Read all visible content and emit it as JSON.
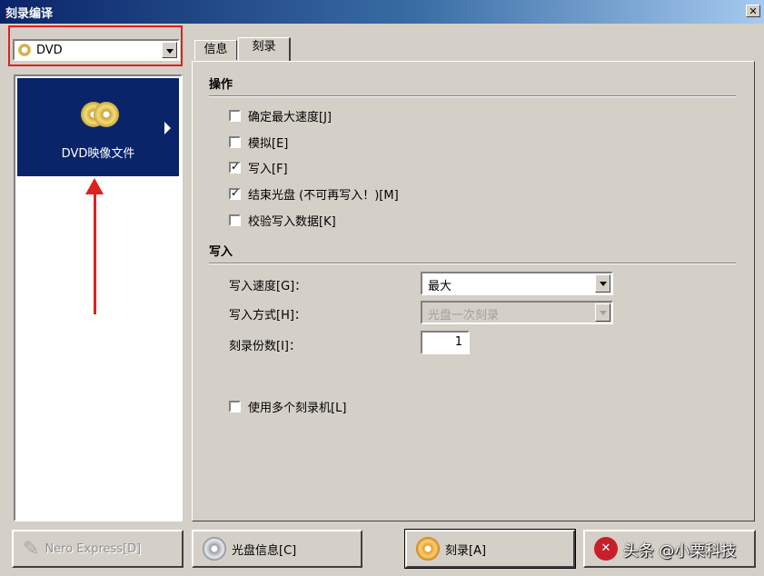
{
  "window": {
    "title": "刻录编译",
    "close_glyph": "✕"
  },
  "disc_type": {
    "selected": "DVD"
  },
  "left_list": {
    "items": [
      {
        "label": "DVD映像文件",
        "icon": "dvd-discs-icon"
      }
    ]
  },
  "tabs": [
    {
      "label": "信息"
    },
    {
      "label": "刻录"
    }
  ],
  "operations": {
    "title": "操作",
    "options": [
      {
        "label": "确定最大速度[J]",
        "checked": false
      },
      {
        "label": "模拟[E]",
        "checked": false
      },
      {
        "label": "写入[F]",
        "checked": true
      },
      {
        "label": "结束光盘 (不可再写入！)[M]",
        "checked": true
      },
      {
        "label": "校验写入数据[K]",
        "checked": false
      }
    ]
  },
  "write": {
    "title": "写入",
    "speed_label": "写入速度[G]：",
    "speed_value": "最大",
    "method_label": "写入方式[H]：",
    "method_value": "光盘一次刻录",
    "copies_label": "刻录份数[I]：",
    "copies_value": "1",
    "multi_recorder_label": "使用多个刻录机[L]",
    "multi_recorder_checked": false
  },
  "buttons": {
    "nero_express": "Nero Express[D]",
    "disc_info": "光盘信息[C]",
    "burn": "刻录[A]",
    "cancel": "头条 @小栗科技"
  },
  "colors": {
    "selection": "#0a246a",
    "annotation": "#e0201c",
    "face": "#d4d0c8"
  }
}
